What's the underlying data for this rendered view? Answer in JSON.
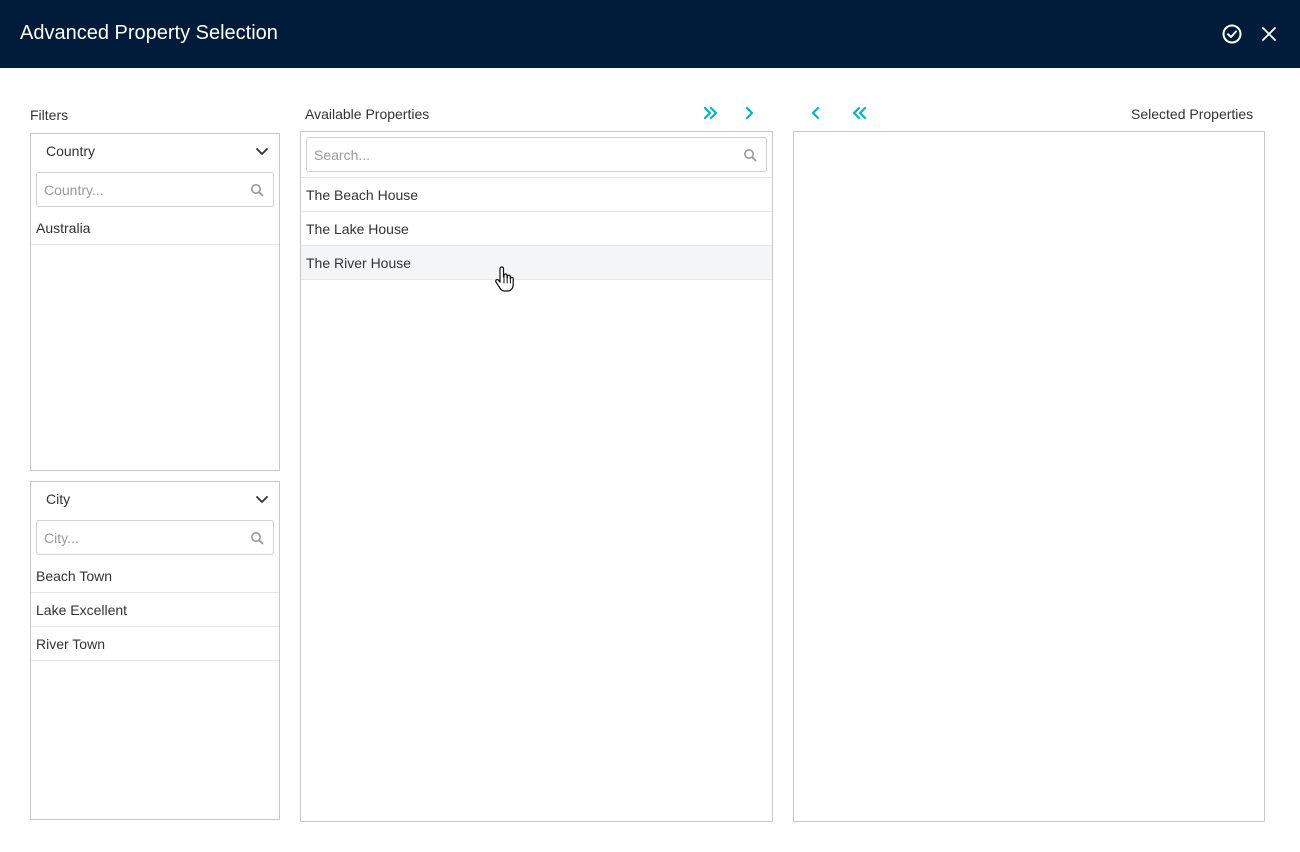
{
  "window": {
    "title": "Advanced Property Selection"
  },
  "icons": {
    "confirm": "check-circle-icon",
    "close": "close-icon",
    "move_all_right": "double-chevron-right-icon",
    "move_right": "chevron-right-icon",
    "move_left": "chevron-left-icon",
    "move_all_left": "double-chevron-left-icon"
  },
  "colors": {
    "titlebar": "#001c3a",
    "accent": "#00b8c8",
    "border": "#c8c8c8"
  },
  "filters": {
    "label": "Filters",
    "country": {
      "header": "Country",
      "placeholder": "Country...",
      "items": [
        "Australia"
      ]
    },
    "city": {
      "header": "City",
      "placeholder": "City...",
      "items": [
        "Beach Town",
        "Lake Excellent",
        "River Town"
      ]
    }
  },
  "available": {
    "label": "Available Properties",
    "placeholder": "Search...",
    "items": [
      "The Beach House",
      "The Lake House",
      "The River House"
    ]
  },
  "selected": {
    "label": "Selected Properties",
    "items": []
  }
}
